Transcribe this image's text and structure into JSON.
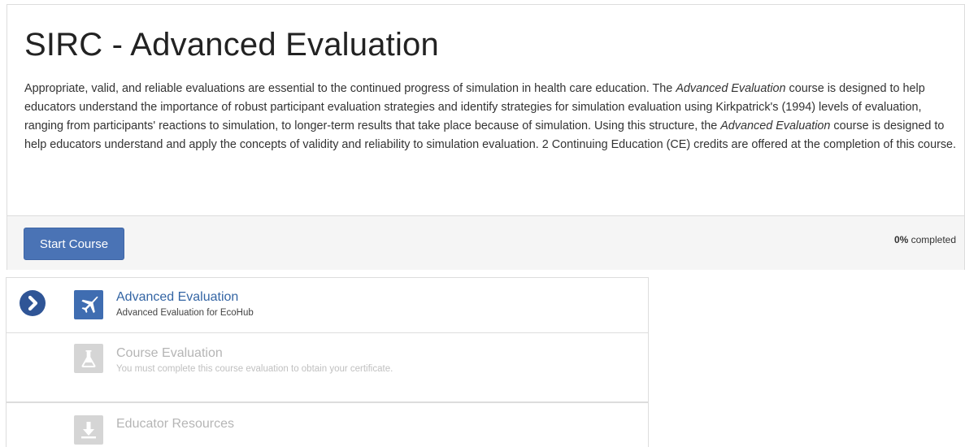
{
  "course": {
    "title": "SIRC - Advanced Evaluation",
    "description": {
      "p1": "Appropriate, valid, and reliable evaluations are essential to the continued progress of simulation in health care education. The ",
      "em1": "Advanced Evaluation",
      "p2": " course is designed to help educators understand the importance of robust participant evaluation strategies and identify strategies for simulation evaluation using Kirkpatrick's (1994) levels of evaluation, ranging from participants' reactions to simulation, to longer-term results that take place because of simulation. Using this structure, the ",
      "em2": "Advanced Evaluation",
      "p3": " course is designed to help educators understand and apply the concepts of validity and reliability to simulation evaluation. 2 Continuing Education (CE) credits are offered at the completion of this course."
    },
    "start_button_label": "Start Course",
    "progress": {
      "percent_label": "0%",
      "suffix": " completed",
      "value": 0
    }
  },
  "modules": [
    {
      "title": "Advanced Evaluation",
      "subtitle": "Advanced Evaluation for EcoHub",
      "icon": "airplane-icon",
      "state": "current",
      "marker_icon": "chevron-right-circle-icon"
    },
    {
      "title": "Course Evaluation",
      "subtitle": "You must complete this course evaluation to obtain your certificate.",
      "icon": "flask-icon",
      "state": "locked"
    },
    {
      "title": "Educator Resources",
      "subtitle": "",
      "icon": "download-icon",
      "state": "locked"
    }
  ],
  "colors": {
    "primary": "#4a73b5",
    "chevron": "#2f5596",
    "active_icon": "#3f6db1",
    "link": "#3465a4",
    "disabled": "#d5d5d5"
  }
}
